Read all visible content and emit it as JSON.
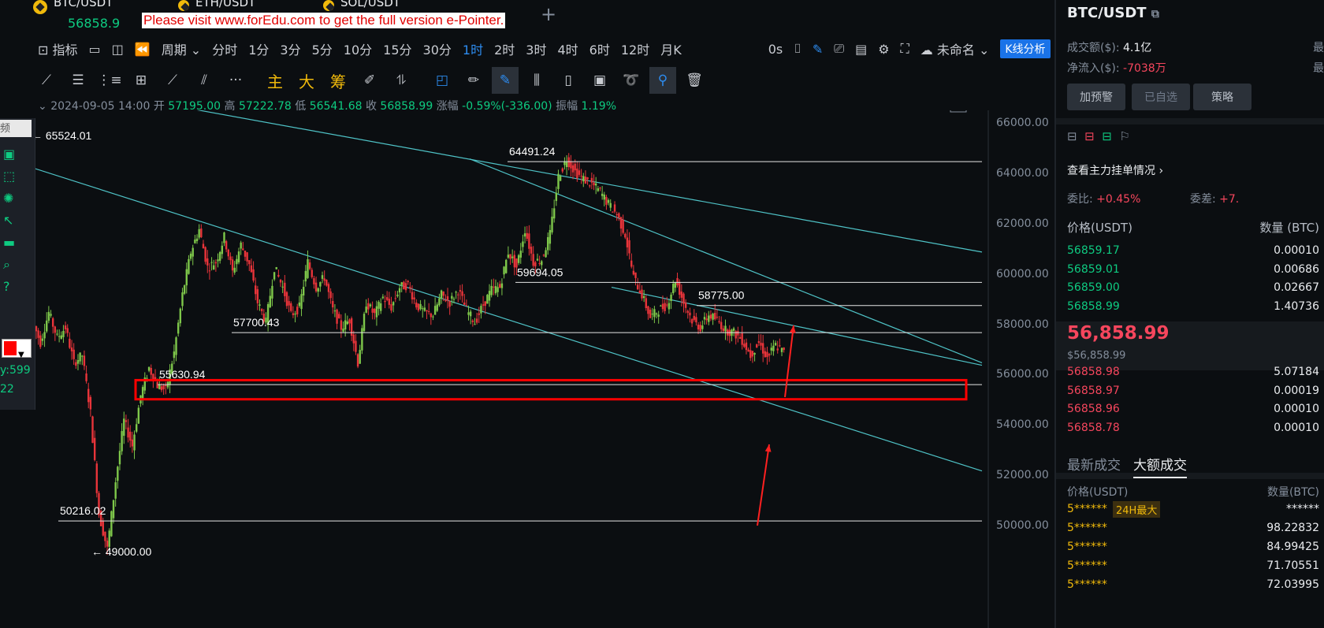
{
  "tabs": [
    {
      "name": "BTC/USDT",
      "price": "56858.9"
    },
    {
      "name": "ETH/USDT"
    },
    {
      "name": "SOL/USDT"
    }
  ],
  "promo_text": "Please visit www.forEdu.com to get the full version e-Pointer.",
  "toolbar": {
    "indicators": "指标",
    "period": "周期",
    "intervals": [
      "分时",
      "1分",
      "3分",
      "5分",
      "10分",
      "15分",
      "30分",
      "1时",
      "2时",
      "3时",
      "4时",
      "6时",
      "12时",
      "月K"
    ],
    "active_interval": "1时",
    "countdown": "0s",
    "layout_name": "未命名",
    "kline_analysis": "K线分析"
  },
  "drawbar": {
    "labels": [
      "主",
      "大",
      "筹"
    ]
  },
  "ohlc": {
    "datetime": "2024-09-05 14:00",
    "open_label": "开",
    "open": "57195.00",
    "high_label": "高",
    "high": "57222.78",
    "low_label": "低",
    "low": "56541.68",
    "close_label": "收",
    "close": "56858.99",
    "change_label": "涨幅",
    "change": "-0.59%(-336.00)",
    "amp_label": "振幅",
    "amp": "1.19%"
  },
  "left_panel": {
    "text1": "频",
    "text2": "y:599",
    "text3": "22"
  },
  "chart_data": {
    "type": "candlestick",
    "symbol": "BTC/USDT",
    "ylim": [
      49000,
      66500
    ],
    "y_ticks": [
      "66000.00",
      "64000.00",
      "62000.00",
      "60000.00",
      "58000.00",
      "56000.00",
      "54000.00",
      "52000.00",
      "50000.00"
    ],
    "levels": [
      {
        "label": "64491.24",
        "value": 64491.24
      },
      {
        "label": "59694.05",
        "value": 59694.05
      },
      {
        "label": "58775.00",
        "value": 58775.0
      },
      {
        "label": "57700.43",
        "value": 57700.43
      },
      {
        "label": "55630.94",
        "value": 55630.94
      },
      {
        "label": "50216.02",
        "value": 50216.02
      }
    ],
    "markers": [
      {
        "label": "← 65524.01",
        "value": 65524.01
      },
      {
        "label": "← 49000.00",
        "value": 49000.0
      }
    ],
    "close_path": [
      58200,
      57300,
      58500,
      57500,
      57900,
      56500,
      56800,
      54500,
      50500,
      49100,
      51800,
      54200,
      53200,
      55200,
      56300,
      55600,
      55400,
      56900,
      59200,
      60900,
      61800,
      60300,
      60500,
      61500,
      60100,
      61200,
      60400,
      58900,
      58100,
      60300,
      59500,
      58400,
      58700,
      60500,
      59500,
      59900,
      58600,
      57900,
      58200,
      56500,
      58900,
      58400,
      59100,
      58700,
      59500,
      59600,
      58800,
      58500,
      58400,
      59200,
      58900,
      59400,
      58600,
      58100,
      58800,
      59400,
      59500,
      60900,
      60300,
      61800,
      60500,
      60600,
      61600,
      63900,
      64600,
      64100,
      63800,
      63600,
      63300,
      62800,
      62400,
      61600,
      59900,
      59200,
      58300,
      58600,
      58800,
      59800,
      58900,
      58200,
      57900,
      58400,
      58200,
      57800,
      57700,
      57400,
      56800,
      57300,
      56700,
      57200,
      56900
    ]
  },
  "right_panel": {
    "title": "BTC/USDT",
    "volume_label": "成交额($):",
    "volume": "4.1亿",
    "netflow_label": "净流入($):",
    "netflow": "-7038万",
    "btn_alert": "加预警",
    "btn_fav": "已自选",
    "btn_strategy": "策略",
    "main_orders": "查看主力挂单情况",
    "ratio_label": "委比:",
    "ratio": "+0.45%",
    "diff_label": "委差:",
    "diff": "+7.",
    "col_price": "价格(USDT)",
    "col_qty": "数量 (BTC)",
    "asks_green": [
      {
        "p": "56859.17",
        "q": "0.00010"
      },
      {
        "p": "56859.01",
        "q": "0.00686"
      },
      {
        "p": "56859.00",
        "q": "0.02667"
      },
      {
        "p": "56858.99",
        "q": "1.40736"
      }
    ],
    "last_price": "56,858.99",
    "last_price_usd": "$56,858.99",
    "bids_red": [
      {
        "p": "56858.98",
        "q": "5.07184"
      },
      {
        "p": "56858.97",
        "q": "0.00019"
      },
      {
        "p": "56858.96",
        "q": "0.00010"
      },
      {
        "p": "56858.78",
        "q": "0.00010"
      }
    ],
    "tab_latest": "最新成交",
    "tab_large": "大额成交",
    "col_price2": "价格(USDT)",
    "col_qty2": "数量(BTC)",
    "trades": [
      {
        "p": "5******",
        "tag": "24H最大",
        "q": "******"
      },
      {
        "p": "5******",
        "q": "98.22832"
      },
      {
        "p": "5******",
        "q": "84.99425"
      },
      {
        "p": "5******",
        "q": "71.70551"
      },
      {
        "p": "5******",
        "q": "72.03995"
      }
    ],
    "side_labels": [
      "最",
      "最"
    ]
  }
}
